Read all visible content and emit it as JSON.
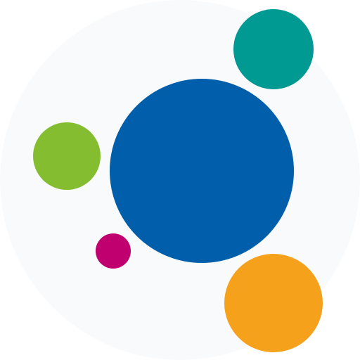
{
  "logo": {
    "background_color": "#F8FAFC",
    "circles": [
      {
        "name": "blue",
        "color": "#005EAA"
      },
      {
        "name": "teal",
        "color": "#009A93"
      },
      {
        "name": "green",
        "color": "#84BD2F"
      },
      {
        "name": "magenta",
        "color": "#C0006E"
      },
      {
        "name": "orange",
        "color": "#F6A11B"
      }
    ]
  }
}
